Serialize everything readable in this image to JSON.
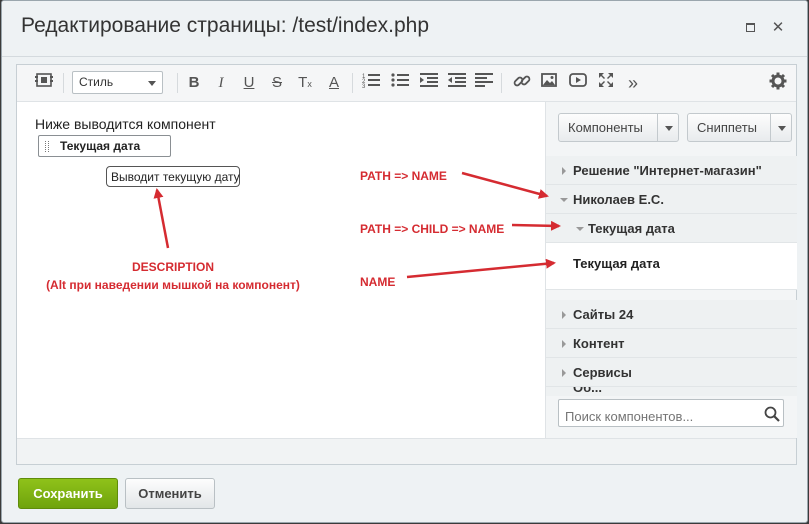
{
  "window": {
    "title": "Редактирование страницы: /test/index.php"
  },
  "toolbar": {
    "style_select": "Стиль",
    "icons": [
      "source-view-icon",
      "bold-icon",
      "italic-icon",
      "underline-icon",
      "strikethrough-icon",
      "clear-format-icon",
      "font-color-icon",
      "ordered-list-icon",
      "unordered-list-icon",
      "indent-icon",
      "outdent-icon",
      "align-icon",
      "link-icon",
      "image-icon",
      "video-icon",
      "fullscreen-icon",
      "more-icon",
      "settings-icon"
    ]
  },
  "content": {
    "intro_text": "Ниже выводится компонент",
    "component_label": "Текущая дата",
    "tooltip": "Выводит текущую дату"
  },
  "annotations": {
    "path_name": "PATH => NAME",
    "path_child_name": "PATH => CHILD => NAME",
    "name": "NAME",
    "description": "DESCRIPTION",
    "description_hint": "(Alt при наведении мышкой на компонент)",
    "color": "#d52b31"
  },
  "sidebar": {
    "components_button": "Компоненты",
    "snippets_button": "Сниппеты",
    "tree": [
      {
        "label": "Решение \"Интернет-магазин\"",
        "expanded": false
      },
      {
        "label": "Николаев Е.С.",
        "expanded": true
      },
      {
        "label": "Текущая дата",
        "expanded": true
      },
      {
        "label": "Сайты 24",
        "expanded": false
      },
      {
        "label": "Контент",
        "expanded": false
      },
      {
        "label": "Сервисы",
        "expanded": false
      },
      {
        "label": "Об...",
        "expanded": false
      }
    ],
    "leaf": "Текущая дата",
    "search_placeholder": "Поиск компонентов..."
  },
  "footer": {
    "save": "Сохранить",
    "cancel": "Отменить"
  },
  "colors": {
    "accent_green": "#7ab317",
    "background": "#eef2f4"
  }
}
